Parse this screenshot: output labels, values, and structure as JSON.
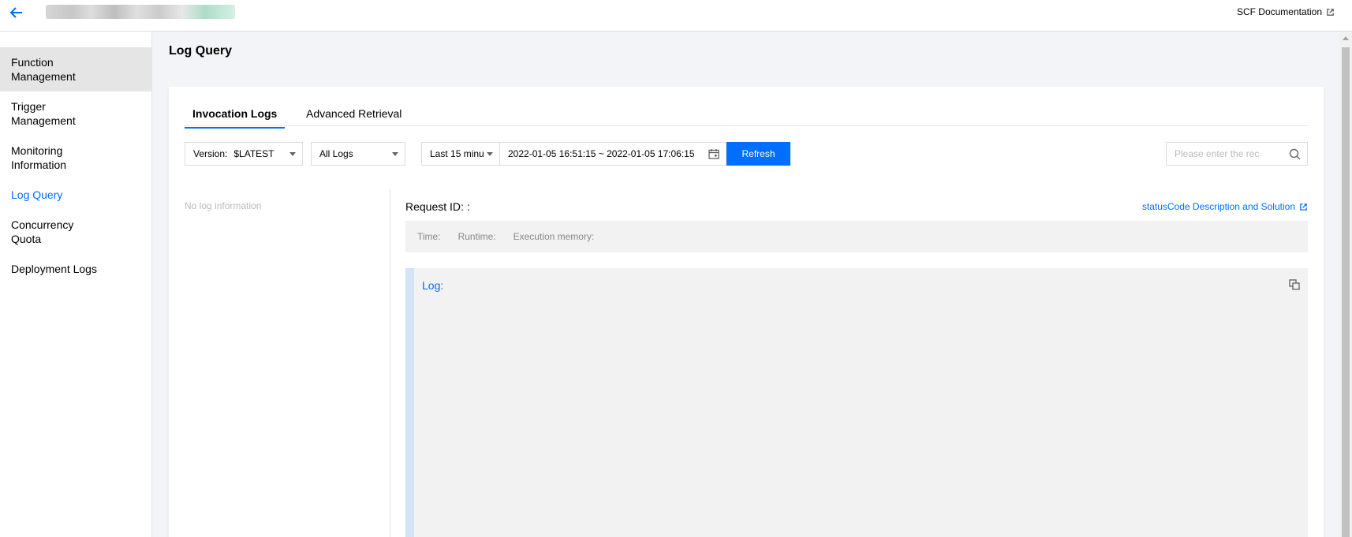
{
  "topbar": {
    "doc_link": "SCF Documentation",
    "icons": [
      "back-arrow-icon",
      "external-link-icon"
    ]
  },
  "sidebar": {
    "items": [
      {
        "label_line1": "Function",
        "label_line2": "Management",
        "state": "highlighted"
      },
      {
        "label_line1": "Trigger",
        "label_line2": "Management",
        "state": "normal"
      },
      {
        "label_line1": "Monitoring",
        "label_line2": "Information",
        "state": "normal"
      },
      {
        "label": "Log Query",
        "state": "current"
      },
      {
        "label_line1": "Concurrency",
        "label_line2": "Quota",
        "state": "normal"
      },
      {
        "label": "Deployment Logs",
        "state": "normal"
      }
    ]
  },
  "main": {
    "title": "Log Query",
    "tabs": [
      {
        "label": "Invocation Logs",
        "active": true
      },
      {
        "label": "Advanced Retrieval",
        "active": false
      }
    ],
    "filters": {
      "version_label": "Version:",
      "version_value": "$LATEST",
      "log_type": "All Logs",
      "time_range": "Last 15 minu",
      "date_range": "2022-01-05 16:51:15 ~ 2022-01-05 17:06:15",
      "refresh_label": "Refresh",
      "search_placeholder": "Please enter the rec"
    },
    "list": {
      "empty_text": "No log information"
    },
    "detail": {
      "request_id_label": "Request ID: :",
      "status_link": "statusCode Description and Solution",
      "time_label": "Time:",
      "runtime_label": "Runtime:",
      "memory_label": "Execution memory:",
      "log_label": "Log:"
    }
  },
  "colors": {
    "accent": "#006eff",
    "page_bg": "#f3f4f7",
    "panel_bg": "#f2f2f2",
    "log_border": "#d4e3f5"
  }
}
